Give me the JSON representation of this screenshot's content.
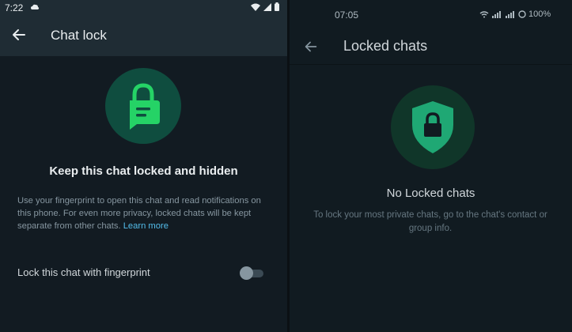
{
  "left": {
    "status_bar": {
      "time": "7:22"
    },
    "app_bar": {
      "title": "Chat lock"
    },
    "content": {
      "heading": "Keep this chat locked and hidden",
      "description": "Use your fingerprint to open this chat and read notifications on this phone. For even more privacy, locked chats will be kept separate from other chats.",
      "learn_more": "Learn more"
    },
    "setting": {
      "label": "Lock this chat with fingerprint",
      "toggle_on": false
    }
  },
  "right": {
    "status_bar": {
      "time": "07:05",
      "battery": "100%"
    },
    "app_bar": {
      "title": "Locked chats"
    },
    "empty_state": {
      "heading": "No Locked chats",
      "description": "To lock your most private chats, go to the chat's contact or group info."
    }
  },
  "colors": {
    "accent": "#25d366",
    "link": "#53bdeb",
    "background": "#121b22",
    "app_bar": "#1f2c34"
  },
  "icons": [
    "back-arrow-icon",
    "chat-lock-icon",
    "shield-lock-icon",
    "cloud-icon",
    "wifi-icon",
    "signal-icon",
    "battery-icon"
  ]
}
